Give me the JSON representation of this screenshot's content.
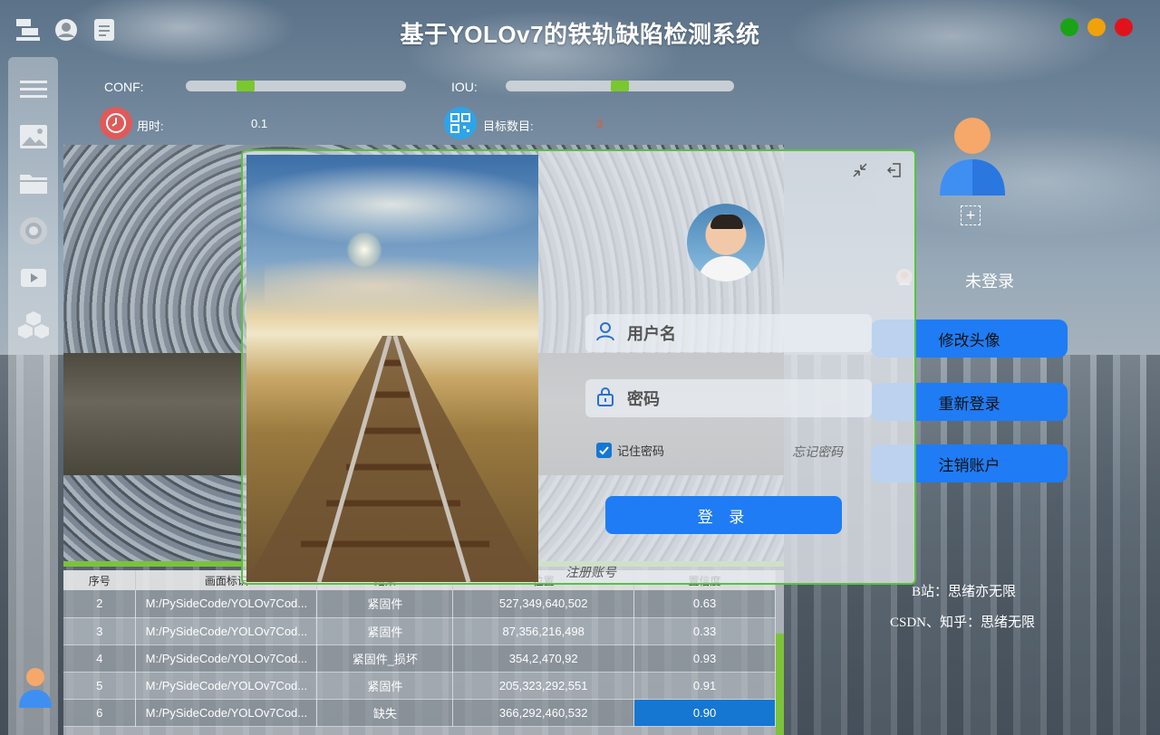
{
  "app": {
    "title": "基于YOLOv7的铁轨缺陷检测系统"
  },
  "header": {
    "icons": [
      "stack-icon",
      "user-circle-icon",
      "document-icon"
    ],
    "window_controls": {
      "colors": [
        "#1aa317",
        "#f1a10a",
        "#e0131d"
      ]
    }
  },
  "sidebar": {
    "items": [
      "menu-icon",
      "image-icon",
      "folder-icon",
      "camera-icon",
      "video-icon",
      "cube-icon"
    ]
  },
  "controls": {
    "conf_label": "CONF:",
    "iou_label": "IOU:",
    "conf_value": 0.25,
    "iou_value": 0.5,
    "time_label": "用时:",
    "time_value": "0.1",
    "count_label": "目标数目:",
    "count_value": "3"
  },
  "table": {
    "headers": [
      "序号",
      "画面标识",
      "结果",
      "位置",
      "置信度"
    ],
    "rows": [
      [
        "2",
        "M:/PySideCode/YOLOv7Cod...",
        "紧固件",
        "527,349,640,502",
        "0.63"
      ],
      [
        "3",
        "M:/PySideCode/YOLOv7Cod...",
        "紧固件",
        "87,356,216,498",
        "0.33"
      ],
      [
        "4",
        "M:/PySideCode/YOLOv7Cod...",
        "紧固件_损坏",
        "354,2,470,92",
        "0.93"
      ],
      [
        "5",
        "M:/PySideCode/YOLOv7Cod...",
        "紧固件",
        "205,323,292,551",
        "0.91"
      ],
      [
        "6",
        "M:/PySideCode/YOLOv7Cod...",
        "缺失",
        "366,292,460,532",
        "0.90"
      ]
    ]
  },
  "right_panel": {
    "status": "未登录",
    "add_symbol": "+",
    "buttons": [
      "修改头像",
      "重新登录",
      "注销账户"
    ],
    "credits": [
      "B站：思绪亦无限",
      "CSDN、知乎：思绪无限"
    ]
  },
  "login": {
    "username_placeholder": "用户名",
    "password_placeholder": "密码",
    "remember_label": "记住密码",
    "remember_checked": true,
    "forgot_label": "忘记密码",
    "login_button": "登 录",
    "register_link": "注册账号"
  }
}
